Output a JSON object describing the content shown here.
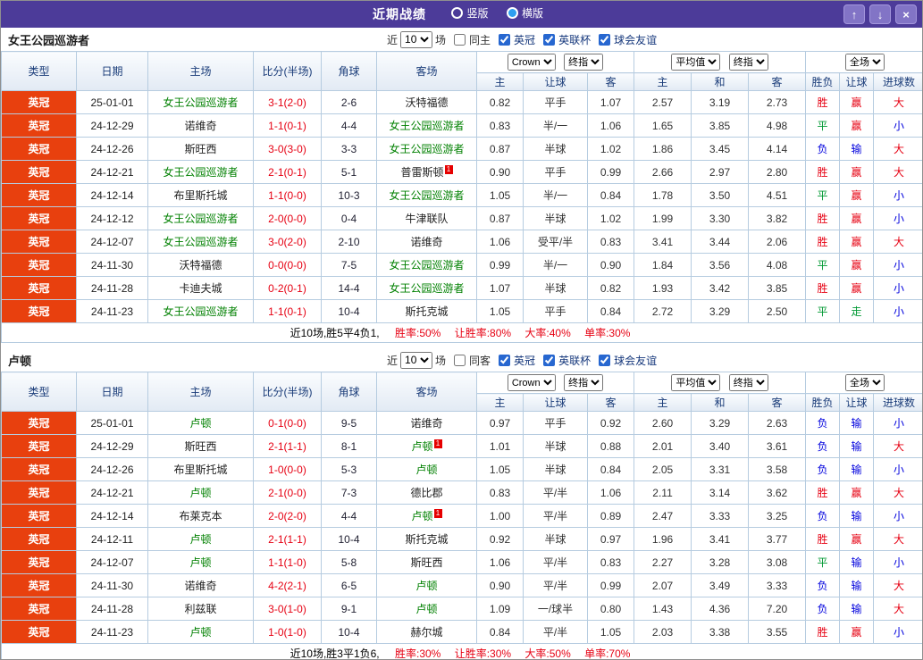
{
  "titlebar": {
    "title": "近期战绩",
    "layout_options": [
      {
        "label": "竖版",
        "selected": false
      },
      {
        "label": "横版",
        "selected": true
      }
    ],
    "buttons": {
      "up": "↑",
      "down": "↓",
      "close": "×"
    }
  },
  "columns": [
    "类型",
    "日期",
    "主场",
    "比分(半场)",
    "角球",
    "客场",
    "主",
    "让球",
    "客",
    "主",
    "和",
    "客",
    "胜负",
    "让球",
    "进球数"
  ],
  "header_controls": {
    "bookmaker": "Crown",
    "final_index": "终指",
    "average": "平均值",
    "final_index2": "终指",
    "scope": "全场"
  },
  "colors": {
    "titlebar_purple": "#4c3b99",
    "league_badge_red": "#e8400e",
    "win_red": "#e60012",
    "draw_green": "#009933",
    "loss_blue": "#0000dd",
    "focal_team_green": "#008000"
  },
  "sections": [
    {
      "team": "女王公园巡游者",
      "filters": {
        "recent_label": "近",
        "count": "10",
        "matches_label": "场",
        "same_venue": {
          "label": "同主",
          "checked": false
        },
        "leagues": [
          {
            "label": "英冠",
            "checked": true
          },
          {
            "label": "英联杯",
            "checked": true
          },
          {
            "label": "球会友谊",
            "checked": true
          }
        ]
      },
      "rows": [
        {
          "lg": "英冠",
          "date": "25-01-01",
          "home": "女王公园巡游者",
          "score": "3-1(2-0)",
          "corner": "2-6",
          "away": "沃特福德",
          "ch": "0.82",
          "line": "平手",
          "ca": "1.07",
          "eh": "2.57",
          "ed": "3.19",
          "ea": "2.73",
          "res": "胜",
          "hcp": "赢",
          "ou": "大"
        },
        {
          "lg": "英冠",
          "date": "24-12-29",
          "home": "诺维奇",
          "score": "1-1(0-1)",
          "corner": "4-4",
          "away": "女王公园巡游者",
          "ch": "0.83",
          "line": "半/一",
          "ca": "1.06",
          "eh": "1.65",
          "ed": "3.85",
          "ea": "4.98",
          "res": "平",
          "hcp": "赢",
          "ou": "小"
        },
        {
          "lg": "英冠",
          "date": "24-12-26",
          "home": "斯旺西",
          "score": "3-0(3-0)",
          "corner": "3-3",
          "away": "女王公园巡游者",
          "ch": "0.87",
          "line": "半球",
          "ca": "1.02",
          "eh": "1.86",
          "ed": "3.45",
          "ea": "4.14",
          "res": "负",
          "hcp": "输",
          "ou": "大"
        },
        {
          "lg": "英冠",
          "date": "24-12-21",
          "home": "女王公园巡游者",
          "score": "2-1(0-1)",
          "corner": "5-1",
          "away": "普雷斯顿",
          "away_sup": "1",
          "ch": "0.90",
          "line": "平手",
          "ca": "0.99",
          "eh": "2.66",
          "ed": "2.97",
          "ea": "2.80",
          "res": "胜",
          "hcp": "赢",
          "ou": "大"
        },
        {
          "lg": "英冠",
          "date": "24-12-14",
          "home": "布里斯托城",
          "score": "1-1(0-0)",
          "corner": "10-3",
          "away": "女王公园巡游者",
          "ch": "1.05",
          "line": "半/一",
          "ca": "0.84",
          "eh": "1.78",
          "ed": "3.50",
          "ea": "4.51",
          "res": "平",
          "hcp": "赢",
          "ou": "小"
        },
        {
          "lg": "英冠",
          "date": "24-12-12",
          "home": "女王公园巡游者",
          "score": "2-0(0-0)",
          "corner": "0-4",
          "away": "牛津联队",
          "ch": "0.87",
          "line": "半球",
          "ca": "1.02",
          "eh": "1.99",
          "ed": "3.30",
          "ea": "3.82",
          "res": "胜",
          "hcp": "赢",
          "ou": "小"
        },
        {
          "lg": "英冠",
          "date": "24-12-07",
          "home": "女王公园巡游者",
          "score": "3-0(2-0)",
          "corner": "2-10",
          "away": "诺维奇",
          "ch": "1.06",
          "line": "受平/半",
          "ca": "0.83",
          "eh": "3.41",
          "ed": "3.44",
          "ea": "2.06",
          "res": "胜",
          "hcp": "赢",
          "ou": "大"
        },
        {
          "lg": "英冠",
          "date": "24-11-30",
          "home": "沃特福德",
          "score": "0-0(0-0)",
          "corner": "7-5",
          "away": "女王公园巡游者",
          "ch": "0.99",
          "line": "半/一",
          "ca": "0.90",
          "eh": "1.84",
          "ed": "3.56",
          "ea": "4.08",
          "res": "平",
          "hcp": "赢",
          "ou": "小"
        },
        {
          "lg": "英冠",
          "date": "24-11-28",
          "home": "卡迪夫城",
          "score": "0-2(0-1)",
          "corner": "14-4",
          "away": "女王公园巡游者",
          "ch": "1.07",
          "line": "半球",
          "ca": "0.82",
          "eh": "1.93",
          "ed": "3.42",
          "ea": "3.85",
          "res": "胜",
          "hcp": "赢",
          "ou": "小"
        },
        {
          "lg": "英冠",
          "date": "24-11-23",
          "home": "女王公园巡游者",
          "score": "1-1(0-1)",
          "corner": "10-4",
          "away": "斯托克城",
          "ch": "1.05",
          "line": "平手",
          "ca": "0.84",
          "eh": "2.72",
          "ed": "3.29",
          "ea": "2.50",
          "res": "平",
          "hcp": "走",
          "ou": "小"
        }
      ],
      "summary": {
        "prefix": "近10场,胜5平4负1,",
        "stats": [
          "胜率:50%",
          "让胜率:80%",
          "大率:40%",
          "单率:30%"
        ]
      }
    },
    {
      "team": "卢顿",
      "filters": {
        "recent_label": "近",
        "count": "10",
        "matches_label": "场",
        "same_venue": {
          "label": "同客",
          "checked": false
        },
        "leagues": [
          {
            "label": "英冠",
            "checked": true
          },
          {
            "label": "英联杯",
            "checked": true
          },
          {
            "label": "球会友谊",
            "checked": true
          }
        ]
      },
      "rows": [
        {
          "lg": "英冠",
          "date": "25-01-01",
          "home": "卢顿",
          "score": "0-1(0-0)",
          "corner": "9-5",
          "away": "诺维奇",
          "ch": "0.97",
          "line": "平手",
          "ca": "0.92",
          "eh": "2.60",
          "ed": "3.29",
          "ea": "2.63",
          "res": "负",
          "hcp": "输",
          "ou": "小"
        },
        {
          "lg": "英冠",
          "date": "24-12-29",
          "home": "斯旺西",
          "score": "2-1(1-1)",
          "corner": "8-1",
          "away": "卢顿",
          "away_sup": "1",
          "ch": "1.01",
          "line": "半球",
          "ca": "0.88",
          "eh": "2.01",
          "ed": "3.40",
          "ea": "3.61",
          "res": "负",
          "hcp": "输",
          "ou": "大"
        },
        {
          "lg": "英冠",
          "date": "24-12-26",
          "home": "布里斯托城",
          "score": "1-0(0-0)",
          "corner": "5-3",
          "away": "卢顿",
          "ch": "1.05",
          "line": "半球",
          "ca": "0.84",
          "eh": "2.05",
          "ed": "3.31",
          "ea": "3.58",
          "res": "负",
          "hcp": "输",
          "ou": "小"
        },
        {
          "lg": "英冠",
          "date": "24-12-21",
          "home": "卢顿",
          "score": "2-1(0-0)",
          "corner": "7-3",
          "away": "德比郡",
          "ch": "0.83",
          "line": "平/半",
          "ca": "1.06",
          "eh": "2.11",
          "ed": "3.14",
          "ea": "3.62",
          "res": "胜",
          "hcp": "赢",
          "ou": "大"
        },
        {
          "lg": "英冠",
          "date": "24-12-14",
          "home": "布莱克本",
          "score": "2-0(2-0)",
          "corner": "4-4",
          "away": "卢顿",
          "away_sup": "1",
          "ch": "1.00",
          "line": "平/半",
          "ca": "0.89",
          "eh": "2.47",
          "ed": "3.33",
          "ea": "3.25",
          "res": "负",
          "hcp": "输",
          "ou": "小"
        },
        {
          "lg": "英冠",
          "date": "24-12-11",
          "home": "卢顿",
          "score": "2-1(1-1)",
          "corner": "10-4",
          "away": "斯托克城",
          "ch": "0.92",
          "line": "半球",
          "ca": "0.97",
          "eh": "1.96",
          "ed": "3.41",
          "ea": "3.77",
          "res": "胜",
          "hcp": "赢",
          "ou": "大"
        },
        {
          "lg": "英冠",
          "date": "24-12-07",
          "home": "卢顿",
          "score": "1-1(1-0)",
          "corner": "5-8",
          "away": "斯旺西",
          "ch": "1.06",
          "line": "平/半",
          "ca": "0.83",
          "eh": "2.27",
          "ed": "3.28",
          "ea": "3.08",
          "res": "平",
          "hcp": "输",
          "ou": "小"
        },
        {
          "lg": "英冠",
          "date": "24-11-30",
          "home": "诺维奇",
          "score": "4-2(2-1)",
          "corner": "6-5",
          "away": "卢顿",
          "ch": "0.90",
          "line": "平/半",
          "ca": "0.99",
          "eh": "2.07",
          "ed": "3.49",
          "ea": "3.33",
          "res": "负",
          "hcp": "输",
          "ou": "大"
        },
        {
          "lg": "英冠",
          "date": "24-11-28",
          "home": "利兹联",
          "score": "3-0(1-0)",
          "corner": "9-1",
          "away": "卢顿",
          "ch": "1.09",
          "line": "一/球半",
          "ca": "0.80",
          "eh": "1.43",
          "ed": "4.36",
          "ea": "7.20",
          "res": "负",
          "hcp": "输",
          "ou": "大"
        },
        {
          "lg": "英冠",
          "date": "24-11-23",
          "home": "卢顿",
          "score": "1-0(1-0)",
          "corner": "10-4",
          "away": "赫尔城",
          "ch": "0.84",
          "line": "平/半",
          "ca": "1.05",
          "eh": "2.03",
          "ed": "3.38",
          "ea": "3.55",
          "res": "胜",
          "hcp": "赢",
          "ou": "小"
        }
      ],
      "summary": {
        "prefix": "近10场,胜3平1负6,",
        "stats": [
          "胜率:30%",
          "让胜率:30%",
          "大率:50%",
          "单率:70%"
        ]
      }
    }
  ]
}
